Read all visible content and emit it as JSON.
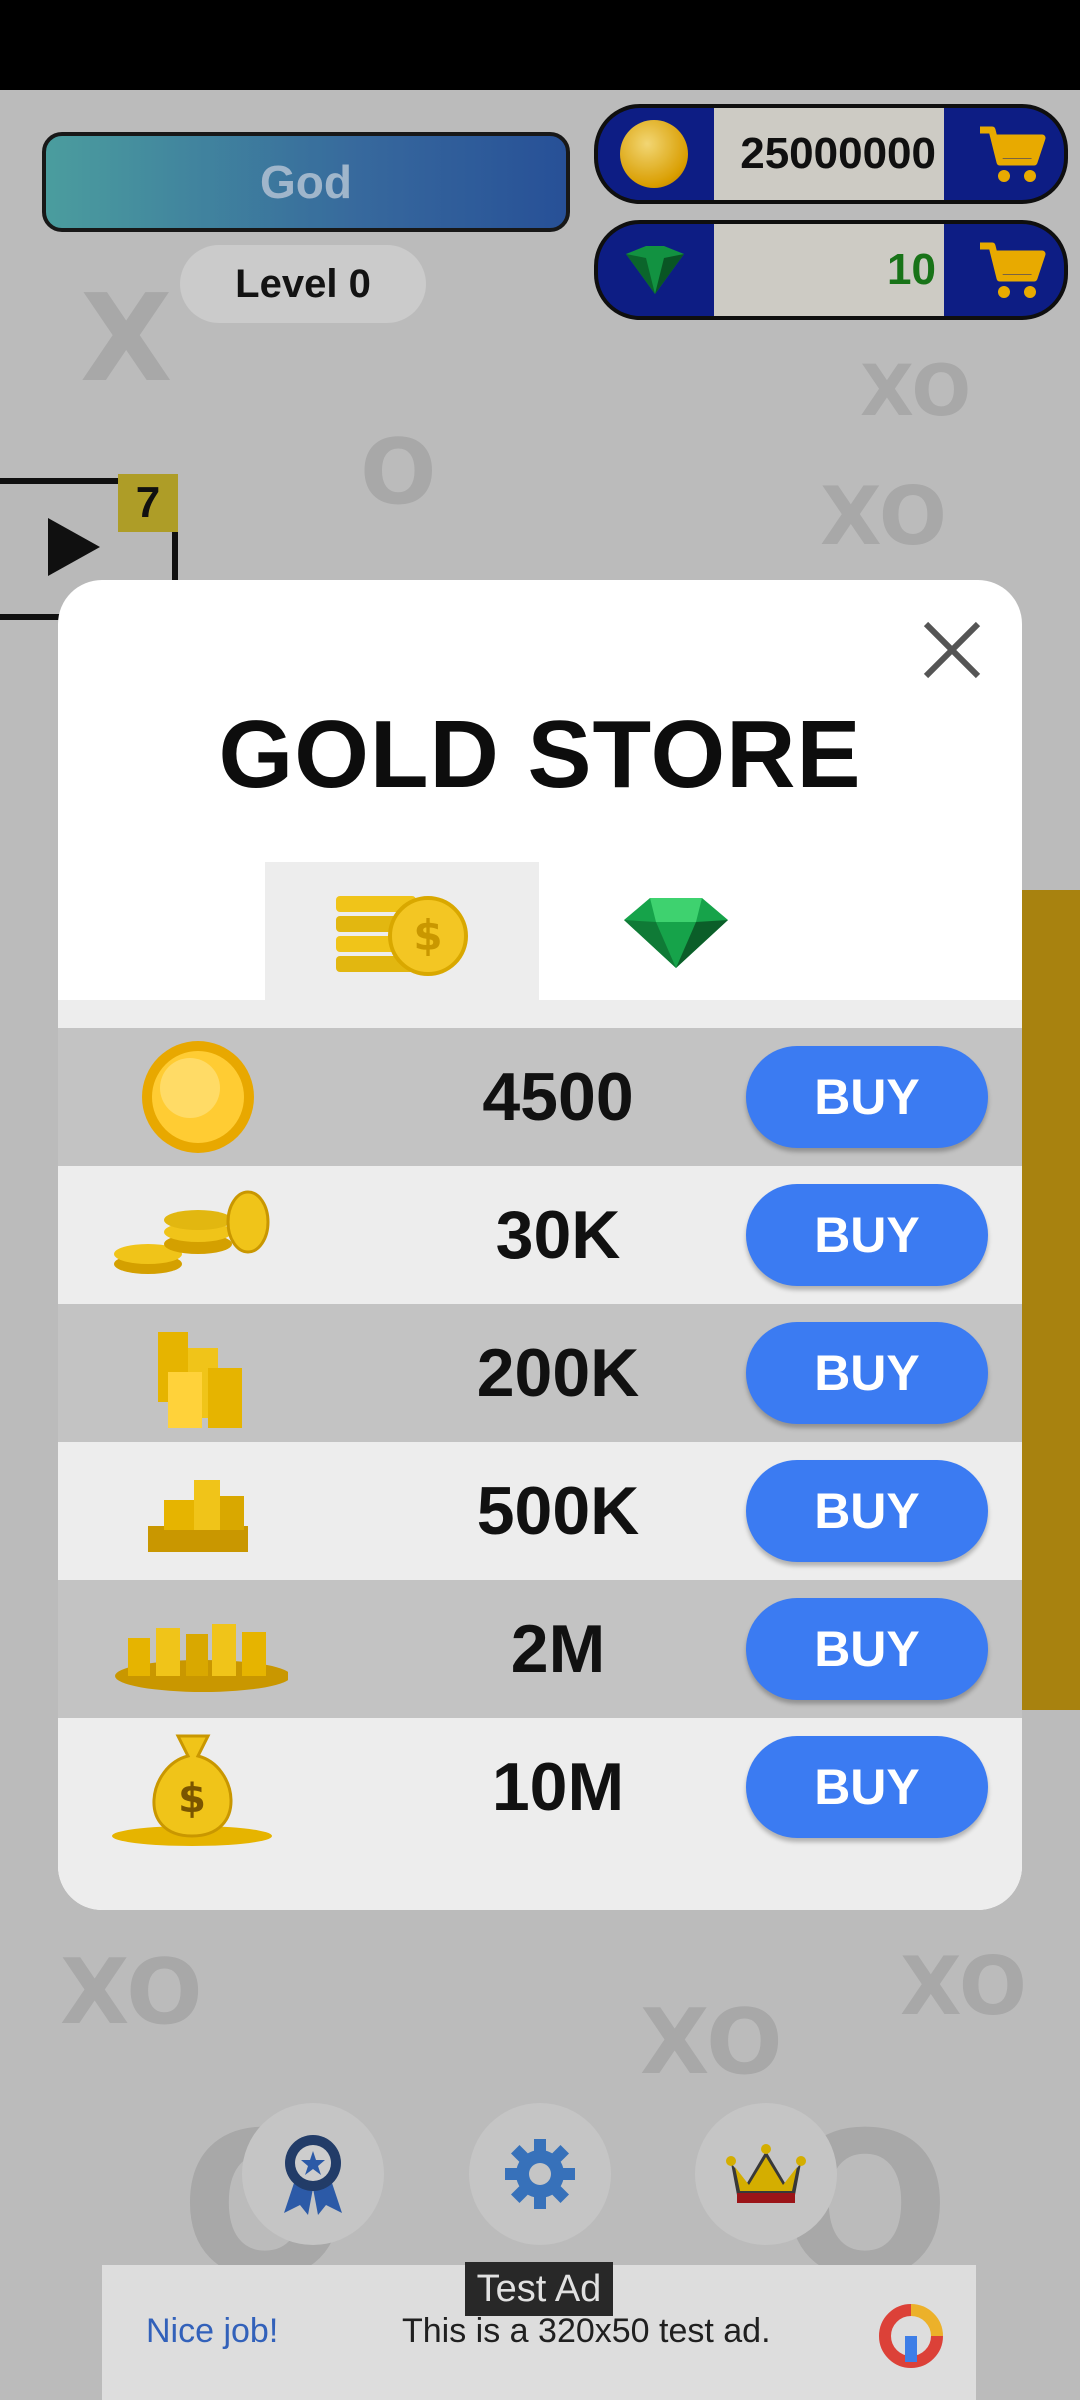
{
  "header": {
    "player_name": "God",
    "level": "Level 0",
    "gold_amount": "25000000",
    "gem_amount": "10"
  },
  "video_reward": {
    "count": "7"
  },
  "store": {
    "title": "GOLD STORE",
    "tabs": [
      {
        "name": "gold-tab",
        "icon": "gold-coins-icon",
        "active": true
      },
      {
        "name": "gems-tab",
        "icon": "emerald-icon",
        "active": false
      }
    ],
    "buy_label": "BUY",
    "items": [
      {
        "amount": "4500",
        "icon": "single-coin-icon"
      },
      {
        "amount": "30K",
        "icon": "coin-pile-small-icon"
      },
      {
        "amount": "200K",
        "icon": "coin-stacks-icon"
      },
      {
        "amount": "500K",
        "icon": "coin-stack-tower-icon"
      },
      {
        "amount": "2M",
        "icon": "coin-heap-icon"
      },
      {
        "amount": "10M",
        "icon": "money-bag-icon"
      }
    ]
  },
  "bottom_nav": [
    {
      "icon": "ribbon-award-icon"
    },
    {
      "icon": "gear-icon"
    },
    {
      "icon": "crown-icon"
    }
  ],
  "ad": {
    "label": "Test Ad",
    "nice": "Nice job!",
    "text": "This is a 320x50 test ad."
  },
  "colors": {
    "buy_button": "#3b7bf2",
    "row_dark": "#c3c3c3",
    "row_light": "#ededed",
    "currency_panel": "#0e1f8c"
  }
}
